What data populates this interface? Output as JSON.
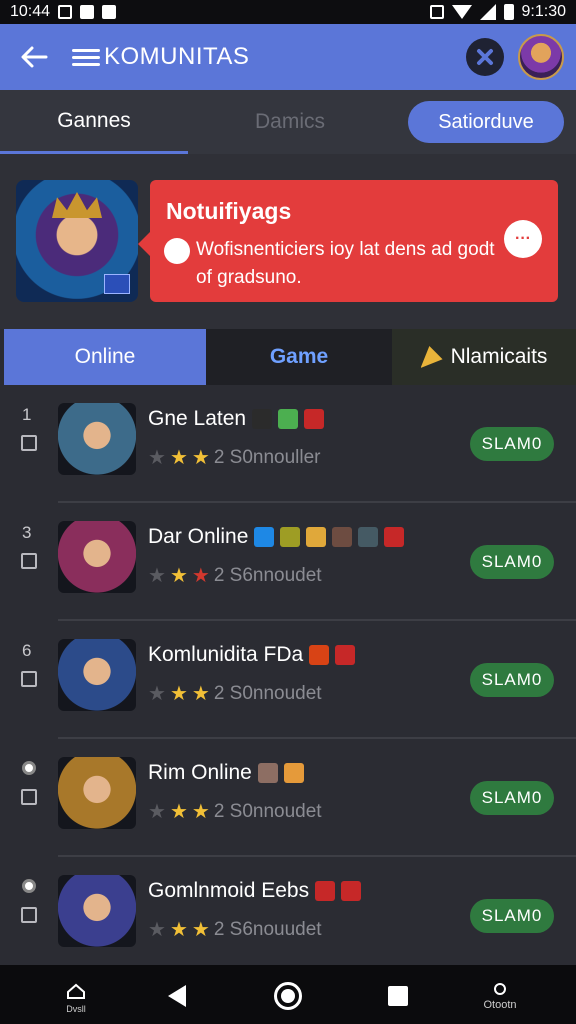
{
  "status_bar": {
    "time": "10:44",
    "right_time": "9:1:30"
  },
  "app_bar": {
    "title": "KOMUNITAS"
  },
  "tabs": {
    "games": "Gannes",
    "dynamics": "Damics",
    "pill": "Satiorduve"
  },
  "notification": {
    "title": "Notuifiyags",
    "text": "Wofisnenticiers ioy lat dens ad godt of gradsuno."
  },
  "segments": {
    "online": "Online",
    "game": "Game",
    "other": "Nlamicaits"
  },
  "colors": {
    "accent": "#5b76d8",
    "alert": "#e33c3c",
    "action": "#2f7a3f",
    "star": "#f2c037"
  },
  "list": [
    {
      "index": "1",
      "name": "Gne Laten",
      "rating_text": "2 S0nnouller",
      "stars": [
        "dim",
        "gold",
        "gold"
      ],
      "button": "SLAM0",
      "thumb": "#3d6b8a",
      "minis": [
        "#2b2b2b",
        "#4caf50",
        "#c62828"
      ]
    },
    {
      "index": "3",
      "name": "Dar Online",
      "rating_text": "2 S6nnoudet",
      "stars": [
        "dim",
        "gold",
        "red"
      ],
      "button": "SLAM0",
      "thumb": "#8a2e5c",
      "minis": [
        "#1e88e5",
        "#9e9d24",
        "#e0a83a",
        "#6d4c41",
        "#455a64",
        "#c62828"
      ]
    },
    {
      "index": "6",
      "name": "Komlunidita FDa",
      "rating_text": "2 S0nnoudet",
      "stars": [
        "dim",
        "gold",
        "gold"
      ],
      "button": "SLAM0",
      "thumb": "#2c4b8a",
      "minis": [
        "#d84315",
        "#c62828"
      ]
    },
    {
      "index": "",
      "name": "Rim Online",
      "rating_text": "2 S0nnoudet",
      "stars": [
        "dim",
        "gold",
        "gold"
      ],
      "button": "SLAM0",
      "thumb": "#a8782a",
      "minis": [
        "#8d6e63",
        "#e59a3a"
      ]
    },
    {
      "index": "",
      "name": "Gomlnmoid Eebs",
      "rating_text": "2 S6nouudet",
      "stars": [
        "dim",
        "gold",
        "gold"
      ],
      "button": "SLAM0",
      "thumb": "#3b3f8f",
      "minis": [
        "#c62828",
        "#c62828"
      ]
    }
  ],
  "nav_bar": {
    "home_label": "Dvsll",
    "extra_label": "Otootn"
  }
}
